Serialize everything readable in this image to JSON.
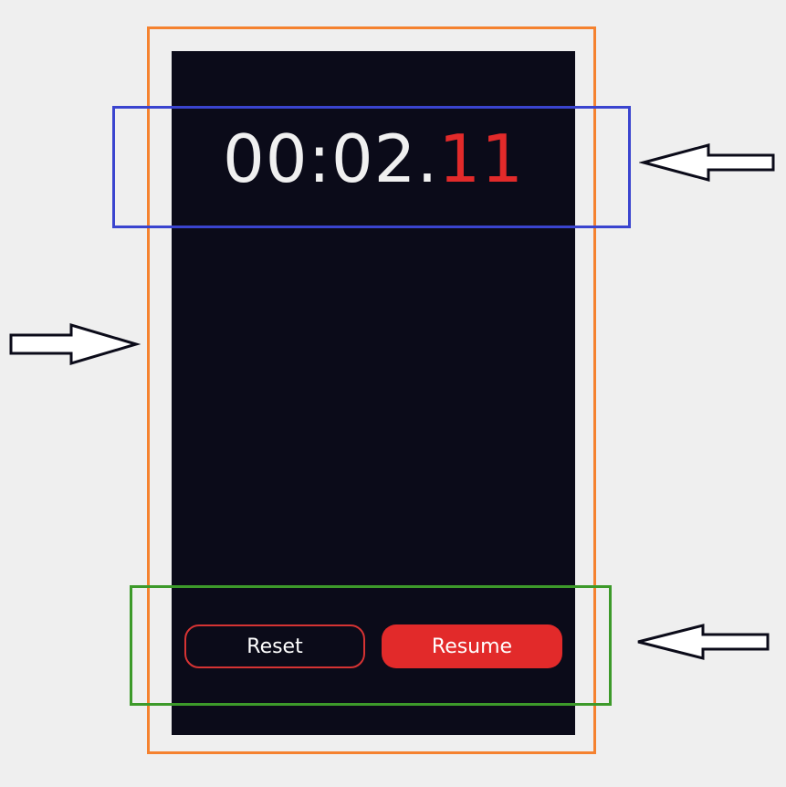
{
  "stopwatch": {
    "time_main": "00:02.",
    "time_hundredths": "11"
  },
  "controls": {
    "reset_label": "Reset",
    "resume_label": "Resume"
  },
  "colors": {
    "background": "#efefef",
    "screen": "#0b0b19",
    "accent_red": "#e22a2a",
    "annotation_orange": "#f5822f",
    "annotation_blue": "#3a44cf",
    "annotation_green": "#3d9a2a"
  },
  "icons": {
    "left_arrow": "arrow-left-icon",
    "right_arrow": "arrow-right-icon"
  }
}
